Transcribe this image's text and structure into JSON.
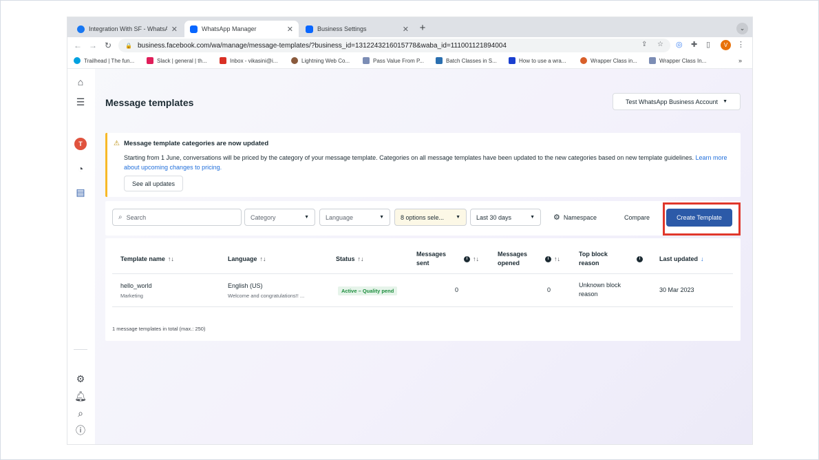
{
  "browser": {
    "tabs": [
      {
        "label": "Integration With SF - WhatsApp",
        "favicon_color": "#1877f2"
      },
      {
        "label": "WhatsApp Manager",
        "favicon_color": "#0866ff"
      },
      {
        "label": "Business Settings",
        "favicon_color": "#0866ff"
      }
    ],
    "url": "business.facebook.com/wa/manage/message-templates/?business_id=1312243216015778&waba_id=111001121894004",
    "profile_initial": "V",
    "bookmarks": [
      {
        "label": "Trailhead | The fun...",
        "color": "#00a1e0"
      },
      {
        "label": "Slack | general | th...",
        "color": "#4a154b"
      },
      {
        "label": "Inbox - vikasini@i...",
        "color": "#d93025"
      },
      {
        "label": "Lightning Web Co...",
        "color": "#8a5a3c"
      },
      {
        "label": "Pass Value From P...",
        "color": "#7c8db5"
      },
      {
        "label": "Batch Classes in S...",
        "color": "#2a6fb0"
      },
      {
        "label": "How to use a wra...",
        "color": "#1a3fd0"
      },
      {
        "label": "Wrapper Class in...",
        "color": "#d85f2a"
      },
      {
        "label": "Wrapper Class In...",
        "color": "#7c8db5"
      }
    ]
  },
  "sidebar": {
    "avatar_initial": "T"
  },
  "header": {
    "title": "Message templates",
    "account_label": "Test WhatsApp Business Account"
  },
  "banner": {
    "title": "Message template categories are now updated",
    "body": "Starting from 1 June, conversations will be priced by the category of your message template. Categories on all message templates have been updated to the new categories based on new template guidelines.",
    "link": "Learn more about upcoming changes to pricing.",
    "button": "See all updates"
  },
  "filters": {
    "search_placeholder": "Search",
    "category": "Category",
    "language": "Language",
    "status": "8 options sele...",
    "date_range": "Last 30 days",
    "namespace": "Namespace",
    "compare": "Compare",
    "create": "Create Template"
  },
  "table": {
    "columns": {
      "name": "Template name",
      "language": "Language",
      "status": "Status",
      "sent_1": "Messages",
      "sent_2": "sent",
      "opened_1": "Messages",
      "opened_2": "opened",
      "reason_1": "Top block",
      "reason_2": "reason",
      "updated": "Last updated"
    },
    "rows": [
      {
        "name": "hello_world",
        "category": "Marketing",
        "language": "English (US)",
        "preview": "Welcome and congratulations!! ...",
        "status": "Active – Quality pend",
        "sent": "0",
        "opened": "0",
        "reason_1": "Unknown block",
        "reason_2": "reason",
        "updated": "30 Mar 2023"
      }
    ],
    "total": "1 message templates in total (max.: 250)"
  }
}
